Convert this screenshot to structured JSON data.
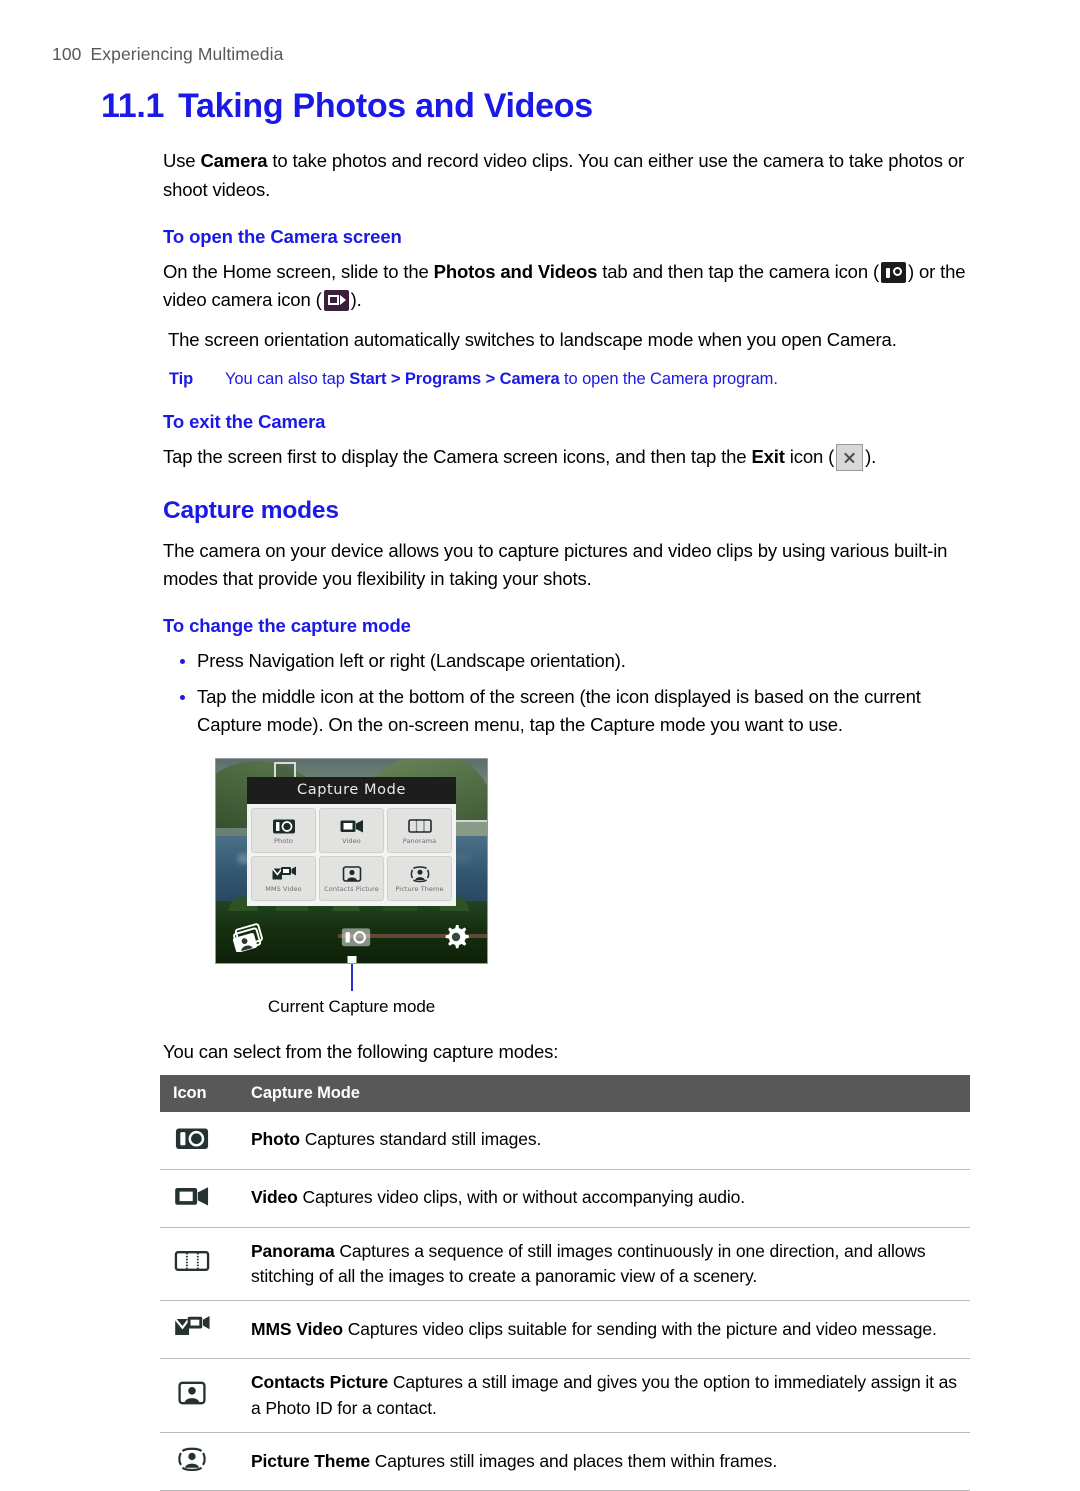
{
  "header": {
    "page_number": "100",
    "chapter_title": "Experiencing Multimedia"
  },
  "section": {
    "number": "11.1",
    "title": "Taking Photos and Videos",
    "intro": "Use Camera to take photos and record video clips. You can either use the camera to take photos or shoot videos.",
    "intro_prefix": "Use ",
    "intro_bold": "Camera",
    "intro_suffix": " to take photos and record video clips. You can either use the camera to take photos or shoot videos."
  },
  "open_camera": {
    "heading": "To open the Camera screen",
    "step_part1": "On the Home screen, slide to the ",
    "step_bold": "Photos and Videos",
    "step_part2": " tab and then tap the camera icon (",
    "step_part3": ") or the video camera icon (",
    "step_part4": ").",
    "note": "The screen orientation automatically switches to landscape mode when you open Camera.",
    "camera_icon_name": "camera-icon",
    "video_icon_name": "video-camera-icon"
  },
  "tip": {
    "label": "Tip",
    "text_part1": "You can also tap ",
    "text_bold": "Start > Programs > Camera",
    "text_part2": " to open the Camera program."
  },
  "exit_camera": {
    "heading": "To exit the Camera",
    "text_part1": "Tap the screen first to display the Camera screen icons, and then tap the ",
    "text_bold": "Exit",
    "text_part2": " icon (",
    "text_part3": ").",
    "exit_icon_name": "exit-icon"
  },
  "capture_modes": {
    "heading": "Capture modes",
    "intro": "The camera on your device allows you to capture pictures and video clips by using various built-in modes that provide you flexibility in taking your shots.",
    "change_heading": "To change the capture mode",
    "bullets": [
      "Press Navigation left or right (Landscape orientation).",
      "Tap the middle icon at the bottom of the screen (the icon displayed is based on the current Capture mode). On the on-screen menu, tap the Capture mode you want to use."
    ],
    "figure_caption": "Current Capture mode",
    "lead_in": "You can select from the following capture modes:"
  },
  "device_screenshot": {
    "menu_title": "Capture Mode",
    "menu_items": [
      {
        "label": "Photo",
        "icon": "photo-icon"
      },
      {
        "label": "Video",
        "icon": "video-icon"
      },
      {
        "label": "Panorama",
        "icon": "panorama-icon"
      },
      {
        "label": "MMS Video",
        "icon": "mms-video-icon"
      },
      {
        "label": "Contacts Picture",
        "icon": "contacts-picture-icon"
      },
      {
        "label": "Picture Theme",
        "icon": "picture-theme-icon"
      }
    ],
    "toolbar": {
      "album_icon": "album-icon",
      "capture_mode_icon": "camera-icon",
      "settings_icon": "gear-icon"
    }
  },
  "table": {
    "headers": {
      "icon": "Icon",
      "mode": "Capture Mode"
    },
    "rows": [
      {
        "icon": "photo-icon",
        "name": "Photo",
        "description": " Captures standard still images."
      },
      {
        "icon": "video-icon",
        "name": "Video",
        "description": " Captures video clips, with or without accompanying audio."
      },
      {
        "icon": "panorama-icon",
        "name": "Panorama",
        "description": " Captures a sequence of still images continuously in one direction, and allows stitching of all the images to create a panoramic view of a scenery."
      },
      {
        "icon": "mms-video-icon",
        "name": "MMS Video",
        "description": " Captures video clips suitable for sending with the picture and video message."
      },
      {
        "icon": "contacts-picture-icon",
        "name": "Contacts Picture",
        "description": " Captures a still image and gives you the option to immediately assign it as a Photo ID for a contact."
      },
      {
        "icon": "picture-theme-icon",
        "name": "Picture Theme",
        "description": " Captures still images and places them within frames."
      }
    ]
  },
  "colors": {
    "heading_blue": "#1a19e6",
    "table_header_gray": "#585858",
    "body_black": "#000000",
    "running_header_gray": "#58585a"
  }
}
